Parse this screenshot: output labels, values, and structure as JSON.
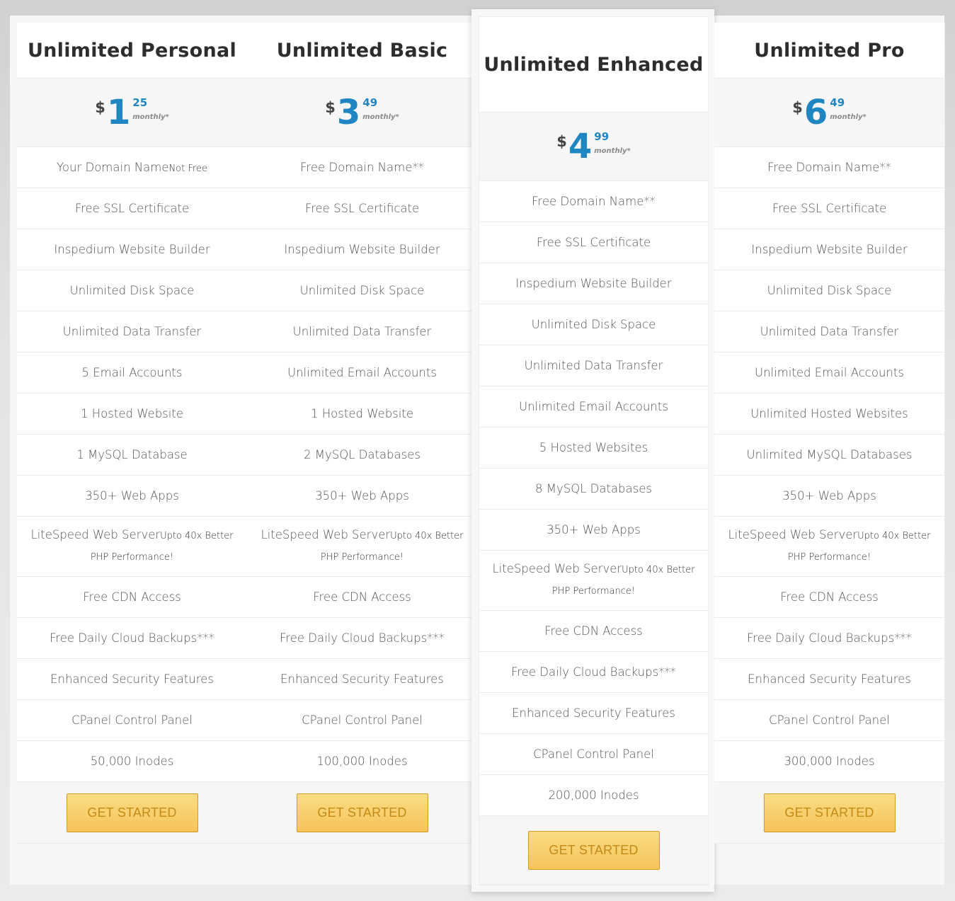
{
  "plans": [
    {
      "name": "Unlimited Personal",
      "price": {
        "currency": "$",
        "dollars": "1",
        "cents": "25",
        "period": "monthly*"
      },
      "features": [
        {
          "main": "Your Domain Name",
          "sub": "Not Free"
        },
        {
          "main": "Free SSL Certificate",
          "sub": ""
        },
        {
          "main": "Inspedium Website Builder",
          "sub": ""
        },
        {
          "main": "Unlimited Disk Space",
          "sub": ""
        },
        {
          "main": "Unlimited Data Transfer",
          "sub": ""
        },
        {
          "main": "5 Email Accounts",
          "sub": ""
        },
        {
          "main": "1 Hosted Website",
          "sub": ""
        },
        {
          "main": "1 MySQL Database",
          "sub": ""
        },
        {
          "main": "350+ Web Apps",
          "sub": ""
        },
        {
          "main": "LiteSpeed Web Server",
          "sub": "Upto 40x Better PHP Performance!"
        },
        {
          "main": "Free CDN Access",
          "sub": ""
        },
        {
          "main": "Free Daily Cloud Backups***",
          "sub": ""
        },
        {
          "main": "Enhanced Security Features",
          "sub": ""
        },
        {
          "main": "CPanel Control Panel",
          "sub": ""
        },
        {
          "main": "50,000 Inodes",
          "sub": ""
        }
      ],
      "button": "GET STARTED",
      "featured": false
    },
    {
      "name": "Unlimited Basic",
      "price": {
        "currency": "$",
        "dollars": "3",
        "cents": "49",
        "period": "monthly*"
      },
      "features": [
        {
          "main": "Free Domain Name**",
          "sub": ""
        },
        {
          "main": "Free SSL Certificate",
          "sub": ""
        },
        {
          "main": "Inspedium Website Builder",
          "sub": ""
        },
        {
          "main": "Unlimited Disk Space",
          "sub": ""
        },
        {
          "main": "Unlimited Data Transfer",
          "sub": ""
        },
        {
          "main": "Unlimited Email Accounts",
          "sub": ""
        },
        {
          "main": "1 Hosted Website",
          "sub": ""
        },
        {
          "main": "2 MySQL Databases",
          "sub": ""
        },
        {
          "main": "350+ Web Apps",
          "sub": ""
        },
        {
          "main": "LiteSpeed Web Server",
          "sub": "Upto 40x Better PHP Performance!"
        },
        {
          "main": "Free CDN Access",
          "sub": ""
        },
        {
          "main": "Free Daily Cloud Backups***",
          "sub": ""
        },
        {
          "main": "Enhanced Security Features",
          "sub": ""
        },
        {
          "main": "CPanel Control Panel",
          "sub": ""
        },
        {
          "main": "100,000 Inodes",
          "sub": ""
        }
      ],
      "button": "GET STARTED",
      "featured": false
    },
    {
      "name": "Unlimited Enhanced",
      "price": {
        "currency": "$",
        "dollars": "4",
        "cents": "99",
        "period": "monthly*"
      },
      "features": [
        {
          "main": "Free Domain Name**",
          "sub": ""
        },
        {
          "main": "Free SSL Certificate",
          "sub": ""
        },
        {
          "main": "Inspedium Website Builder",
          "sub": ""
        },
        {
          "main": "Unlimited Disk Space",
          "sub": ""
        },
        {
          "main": "Unlimited Data Transfer",
          "sub": ""
        },
        {
          "main": "Unlimited Email Accounts",
          "sub": ""
        },
        {
          "main": "5 Hosted Websites",
          "sub": ""
        },
        {
          "main": "8 MySQL Databases",
          "sub": ""
        },
        {
          "main": "350+ Web Apps",
          "sub": ""
        },
        {
          "main": "LiteSpeed Web Server",
          "sub": "Upto 40x Better PHP Performance!"
        },
        {
          "main": "Free CDN Access",
          "sub": ""
        },
        {
          "main": "Free Daily Cloud Backups***",
          "sub": ""
        },
        {
          "main": "Enhanced Security Features",
          "sub": ""
        },
        {
          "main": "CPanel Control Panel",
          "sub": ""
        },
        {
          "main": "200,000 Inodes",
          "sub": ""
        }
      ],
      "button": "GET STARTED",
      "featured": true
    },
    {
      "name": "Unlimited Pro",
      "price": {
        "currency": "$",
        "dollars": "6",
        "cents": "49",
        "period": "monthly*"
      },
      "features": [
        {
          "main": "Free Domain Name**",
          "sub": ""
        },
        {
          "main": "Free SSL Certificate",
          "sub": ""
        },
        {
          "main": "Inspedium Website Builder",
          "sub": ""
        },
        {
          "main": "Unlimited Disk Space",
          "sub": ""
        },
        {
          "main": "Unlimited Data Transfer",
          "sub": ""
        },
        {
          "main": "Unlimited Email Accounts",
          "sub": ""
        },
        {
          "main": "Unlimited Hosted Websites",
          "sub": ""
        },
        {
          "main": "Unlimited MySQL Databases",
          "sub": ""
        },
        {
          "main": "350+ Web Apps",
          "sub": ""
        },
        {
          "main": "LiteSpeed Web Server",
          "sub": "Upto 40x Better PHP Performance!"
        },
        {
          "main": "Free CDN Access",
          "sub": ""
        },
        {
          "main": "Free Daily Cloud Backups***",
          "sub": ""
        },
        {
          "main": "Enhanced Security Features",
          "sub": ""
        },
        {
          "main": "CPanel Control Panel",
          "sub": ""
        },
        {
          "main": "300,000 Inodes",
          "sub": ""
        }
      ],
      "button": "GET STARTED",
      "featured": false
    }
  ],
  "colors": {
    "accent": "#1f86c2",
    "button_top": "#fadc84",
    "button_bottom": "#f5c458",
    "button_text": "#c48a16"
  }
}
